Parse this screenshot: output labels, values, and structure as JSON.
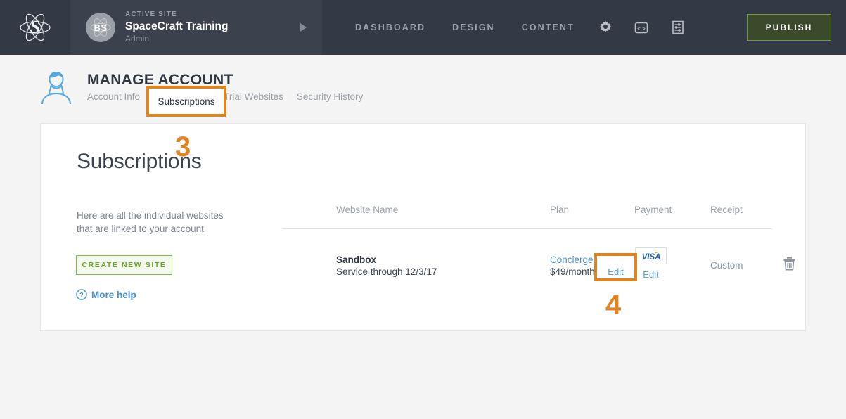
{
  "topbar": {
    "logo_icon": "atom-logo-icon",
    "site": {
      "kicker": "ACTIVE SITE",
      "name": "SpaceCraft Training",
      "role": "Admin",
      "initials": "BS",
      "expand_icon": "play-arrow-icon"
    },
    "nav": [
      {
        "label": "DASHBOARD",
        "name": "nav-dashboard"
      },
      {
        "label": "DESIGN",
        "name": "nav-design"
      },
      {
        "label": "CONTENT",
        "name": "nav-content"
      }
    ],
    "icons": [
      {
        "name": "gear-icon"
      },
      {
        "name": "code-icon"
      },
      {
        "name": "sliders-icon"
      }
    ],
    "publish_label": "PUBLISH",
    "accent_green": "#6f9a3a",
    "bar_bg": "#333a45"
  },
  "page": {
    "title": "MANAGE ACCOUNT",
    "person_icon": "person-icon",
    "tabs": [
      {
        "label": "Account Info",
        "active": false
      },
      {
        "label": "Subscriptions",
        "active": true
      },
      {
        "label": "Trial Websites",
        "active": false
      },
      {
        "label": "Security History",
        "active": false
      }
    ]
  },
  "card": {
    "heading": "Subscriptions",
    "description": "Here are all the individual websites that are linked to your account",
    "create_button": "CREATE NEW SITE",
    "more_help": "More help",
    "help_icon": "question-circle-icon",
    "table": {
      "columns": [
        "Website Name",
        "Plan",
        "Payment",
        "Receipt"
      ],
      "rows": [
        {
          "website_name": "Sandbox",
          "website_sub": "Service through 12/3/17",
          "plan_name": "Concierge",
          "plan_price": "$49/month",
          "payment_card": "VISA",
          "payment_edit": "Edit",
          "receipt": "Custom",
          "delete_icon": "trash-icon"
        }
      ]
    }
  },
  "annotations": {
    "color": "#e08420",
    "step_3": "3",
    "step_4": "4",
    "boxed_tab_label": "Subscriptions",
    "boxed_edit_label": "Edit"
  }
}
